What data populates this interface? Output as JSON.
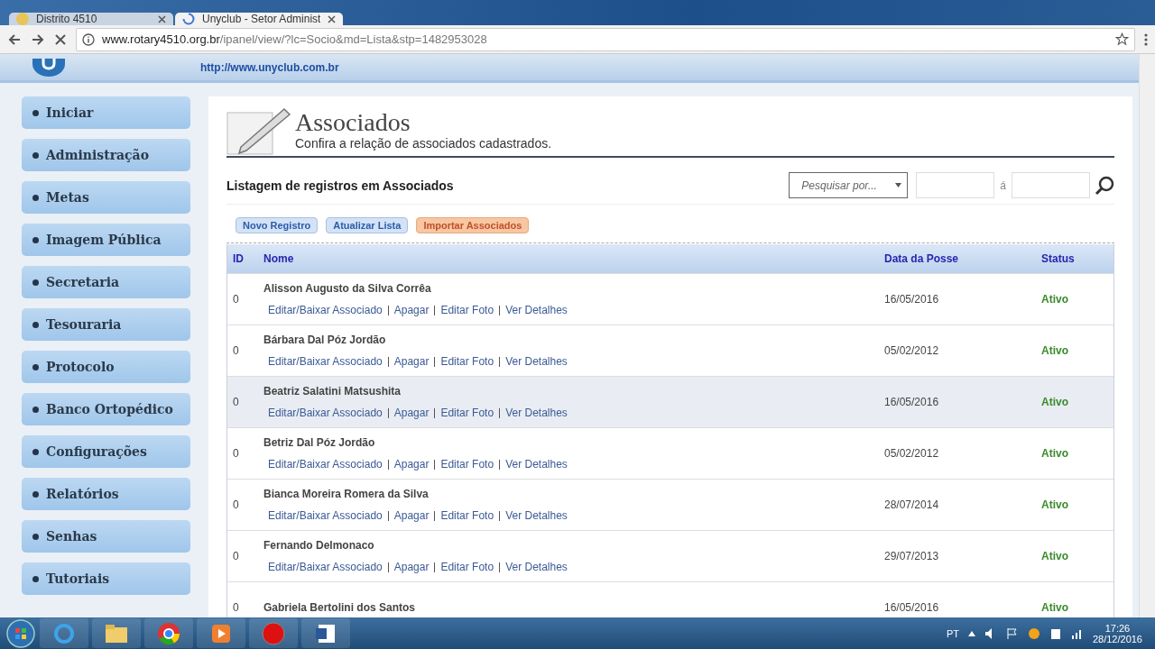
{
  "browser": {
    "tabs": [
      {
        "title": "Distrito 4510",
        "selected": false,
        "loading": false
      },
      {
        "title": "Unyclub - Setor Administ",
        "selected": true,
        "loading": true
      }
    ],
    "url": {
      "host": "www.rotary4510.org.br",
      "path": "/ipanel/view/?lc=Socio&md=Lista&stp=1482953028"
    }
  },
  "header": {
    "site_link": "http://www.unyclub.com.br"
  },
  "sidebar": {
    "items": [
      {
        "label": "Iniciar"
      },
      {
        "label": "Administração"
      },
      {
        "label": "Metas"
      },
      {
        "label": "Imagem Pública"
      },
      {
        "label": "Secretaria"
      },
      {
        "label": "Tesouraria"
      },
      {
        "label": "Protocolo"
      },
      {
        "label": "Banco Ortopédico"
      },
      {
        "label": "Configurações"
      },
      {
        "label": "Relatórios"
      },
      {
        "label": "Senhas"
      },
      {
        "label": "Tutoriais"
      }
    ]
  },
  "page": {
    "title": "Associados",
    "subtitle": "Confira a relação de associados cadastrados.",
    "list_title": "Listagem de registros em Associados",
    "search": {
      "placeholder": "Pesquisar por...",
      "separator": "á"
    },
    "buttons": [
      {
        "label": "Novo Registro",
        "kind": "default"
      },
      {
        "label": "Atualizar Lista",
        "kind": "default"
      },
      {
        "label": "Importar Associados",
        "kind": "import"
      }
    ]
  },
  "table": {
    "columns": [
      "ID",
      "Nome",
      "Data da Posse",
      "Status"
    ],
    "rows": [
      {
        "id": "0",
        "name": "Alisson Augusto da Silva Corrêa",
        "actions": [
          "Editar/Baixar Associado",
          "Apagar",
          "Editar Foto",
          "Ver Detalhes"
        ],
        "date": "16/05/2016",
        "status": "Ativo",
        "highlighted": false
      },
      {
        "id": "0",
        "name": "Bárbara Dal Póz Jordão",
        "actions": [
          "Editar/Baixar Associado",
          "Apagar",
          "Editar Foto",
          "Ver Detalhes"
        ],
        "date": "05/02/2012",
        "status": "Ativo",
        "highlighted": false
      },
      {
        "id": "0",
        "name": "Beatriz Salatini Matsushita",
        "actions": [
          "Editar/Baixar Associado",
          "Apagar",
          "Editar Foto",
          "Ver Detalhes"
        ],
        "date": "16/05/2016",
        "status": "Ativo",
        "highlighted": true
      },
      {
        "id": "0",
        "name": "Betriz Dal Póz Jordão",
        "actions": [
          "Editar/Baixar Associado",
          "Apagar",
          "Editar Foto",
          "Ver Detalhes"
        ],
        "date": "05/02/2012",
        "status": "Ativo",
        "highlighted": false
      },
      {
        "id": "0",
        "name": "Bianca Moreira Romera da Silva",
        "actions": [
          "Editar/Baixar Associado",
          "Apagar",
          "Editar Foto",
          "Ver Detalhes"
        ],
        "date": "28/07/2014",
        "status": "Ativo",
        "highlighted": false
      },
      {
        "id": "0",
        "name": "Fernando Delmonaco",
        "actions": [
          "Editar/Baixar Associado",
          "Apagar",
          "Editar Foto",
          "Ver Detalhes"
        ],
        "date": "29/07/2013",
        "status": "Ativo",
        "highlighted": false
      },
      {
        "id": "0",
        "name": "Gabriela Bertolini dos Santos",
        "date": "16/05/2016",
        "status": "Ativo",
        "highlighted": false
      }
    ]
  },
  "taskbar": {
    "language": "PT",
    "time": "17:26",
    "date": "28/12/2016"
  }
}
